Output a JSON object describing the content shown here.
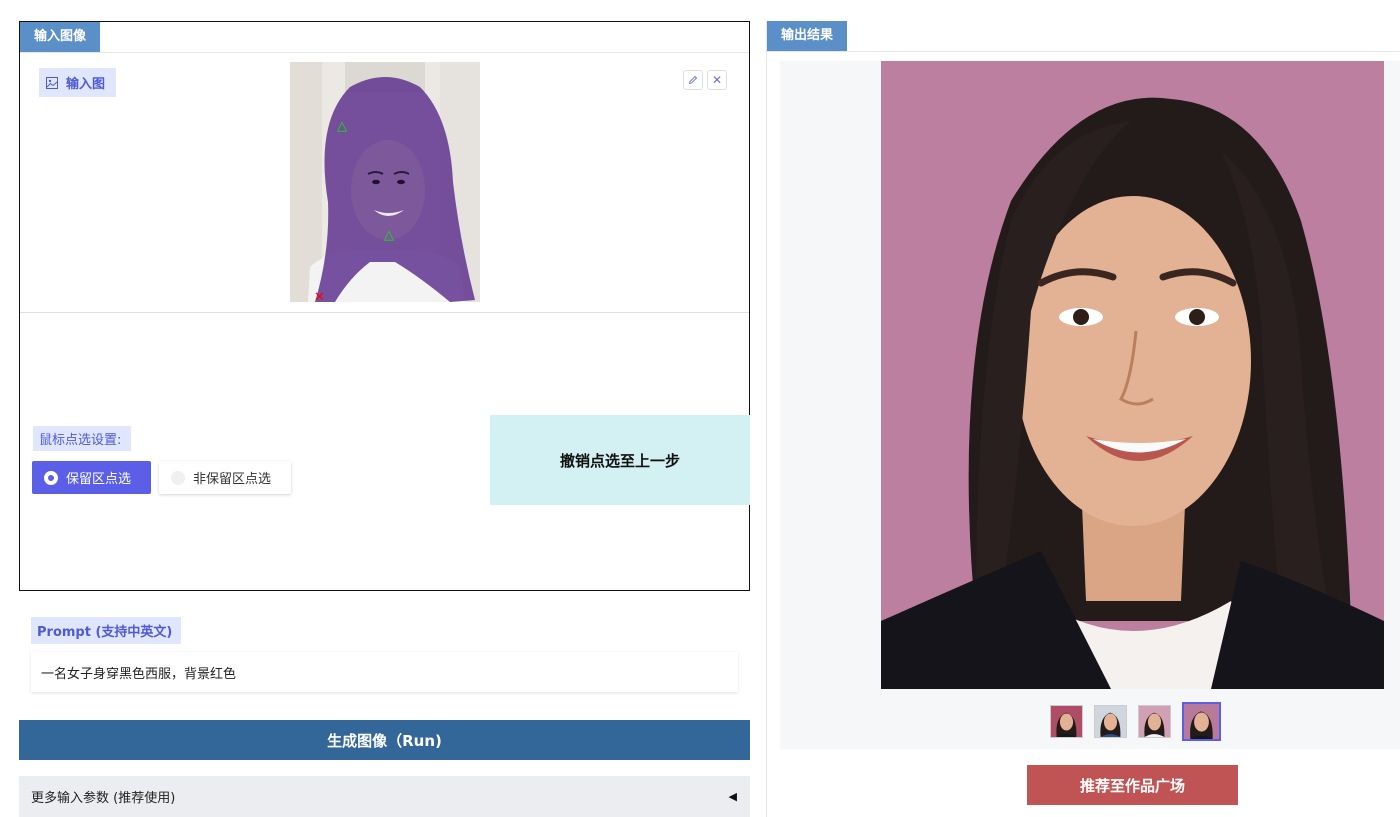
{
  "input_panel": {
    "tab_label": "输入图像",
    "image_label": "输入图",
    "image_icon": "image-icon",
    "edit_icon": "pencil-icon",
    "clear_icon": "close-icon",
    "clear_glyph": "✕",
    "clicks": [
      {
        "kind": "keep",
        "marker": "△",
        "color": "#00ee00"
      },
      {
        "kind": "keep",
        "marker": "△",
        "color": "#00ee00"
      },
      {
        "kind": "exclude",
        "marker": "✕",
        "color": "#ff0000"
      }
    ],
    "settings_label": "鼠标点选设置:",
    "radio_options": [
      "保留区点选",
      "非保留区点选"
    ],
    "selected_option": "保留区点选",
    "undo_button": "撤销点选至上一步"
  },
  "prompt": {
    "label": "Prompt (支持中英文)",
    "value": "一名女子身穿黑色西服，背景红色"
  },
  "run_button": "生成图像（Run)",
  "advanced": {
    "label": "更多输入参数 (推荐使用)",
    "arrow": "◀"
  },
  "output_panel": {
    "tab_label": "输出结果",
    "thumbnail_count": 4,
    "selected_thumbnail": 4,
    "recommend_button": "推荐至作品广场"
  },
  "colors": {
    "tab": "#5b8fc7",
    "label_bg": "#e0e6fb",
    "label_text": "#4f5bd5",
    "accent": "#5b5fe8",
    "undo_bg": "#d3f0f2",
    "run_bg": "#336699",
    "recommend_bg": "#c05353",
    "mask": "#5a2d8c",
    "output_background": "#b87a9a"
  }
}
